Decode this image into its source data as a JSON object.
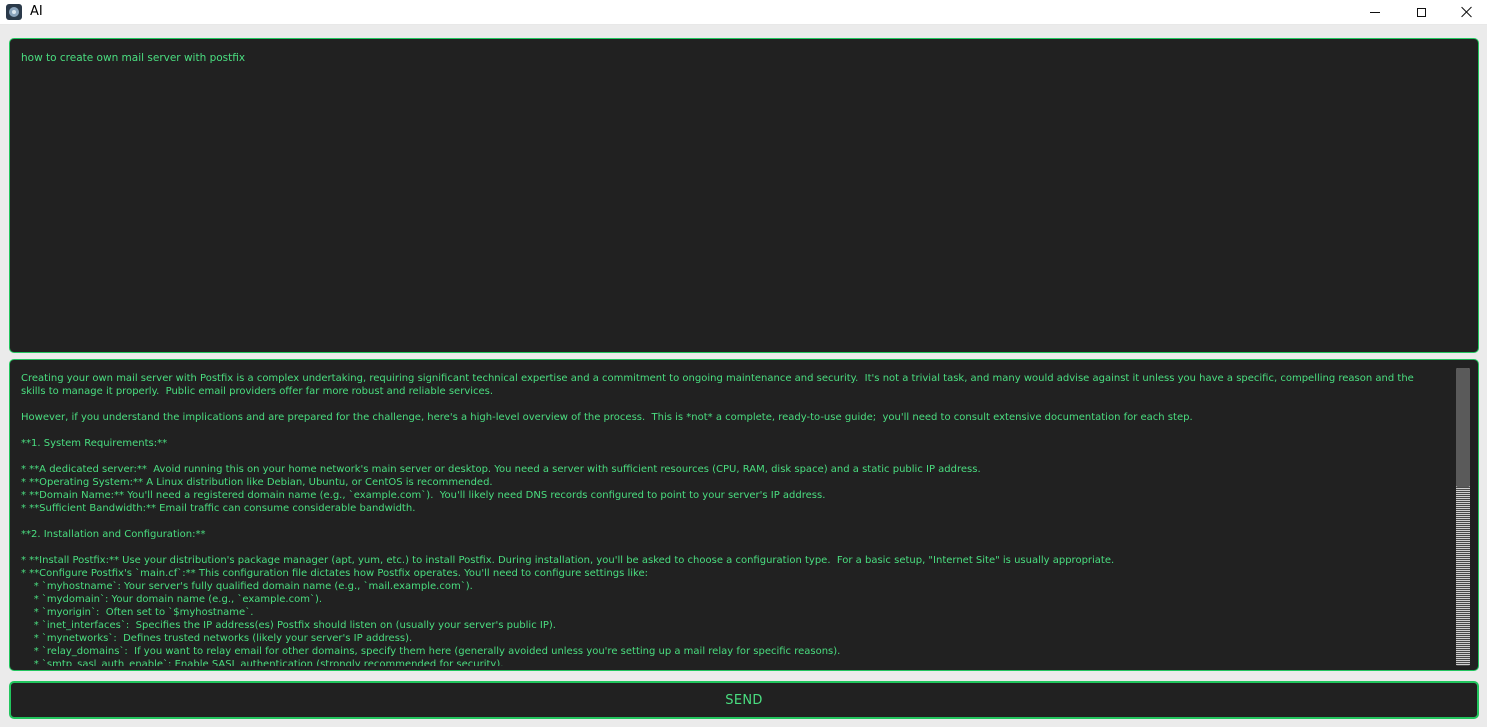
{
  "window": {
    "title": "AI",
    "icon": "app-logo-icon",
    "controls": [
      "minimize-icon",
      "maximize-icon",
      "close-icon"
    ]
  },
  "prompt": {
    "value": "how to create own mail server with postfix"
  },
  "response": {
    "lines": [
      "Creating your own mail server with Postfix is a complex undertaking, requiring significant technical expertise and a commitment to ongoing maintenance and security.  It's not a trivial task, and many would advise against it unless you have a specific, compelling reason and the",
      "skills to manage it properly.  Public email providers offer far more robust and reliable services.",
      "",
      "However, if you understand the implications and are prepared for the challenge, here's a high-level overview of the process.  This is *not* a complete, ready-to-use guide;  you'll need to consult extensive documentation for each step.",
      "",
      "**1. System Requirements:**",
      "",
      "* **A dedicated server:**  Avoid running this on your home network's main server or desktop. You need a server with sufficient resources (CPU, RAM, disk space) and a static public IP address.",
      "* **Operating System:** A Linux distribution like Debian, Ubuntu, or CentOS is recommended.",
      "* **Domain Name:** You'll need a registered domain name (e.g., `example.com`).  You'll likely need DNS records configured to point to your server's IP address.",
      "* **Sufficient Bandwidth:** Email traffic can consume considerable bandwidth.",
      "",
      "**2. Installation and Configuration:**",
      "",
      "* **Install Postfix:** Use your distribution's package manager (apt, yum, etc.) to install Postfix. During installation, you'll be asked to choose a configuration type.  For a basic setup, \"Internet Site\" is usually appropriate.",
      "* **Configure Postfix's `main.cf`:** This configuration file dictates how Postfix operates. You'll need to configure settings like:",
      "    * `myhostname`: Your server's fully qualified domain name (e.g., `mail.example.com`).",
      "    * `mydomain`: Your domain name (e.g., `example.com`).",
      "    * `myorigin`:  Often set to `$myhostname`.",
      "    * `inet_interfaces`:  Specifies the IP address(es) Postfix should listen on (usually your server's public IP).",
      "    * `mynetworks`:  Defines trusted networks (likely your server's IP address).",
      "    * `relay_domains`:  If you want to relay email for other domains, specify them here (generally avoided unless you're setting up a mail relay for specific reasons).",
      "    * `smtp_sasl_auth_enable`: Enable SASL authentication (strongly recommended for security)."
    ]
  },
  "scroll": {
    "position_fraction": 0.0,
    "visible_fraction": 0.4
  },
  "send_button": {
    "label": "SEND"
  },
  "colors": {
    "accent": "#22c55e",
    "text": "#4ade80",
    "panel": "#212121",
    "background": "#ebebeb"
  }
}
